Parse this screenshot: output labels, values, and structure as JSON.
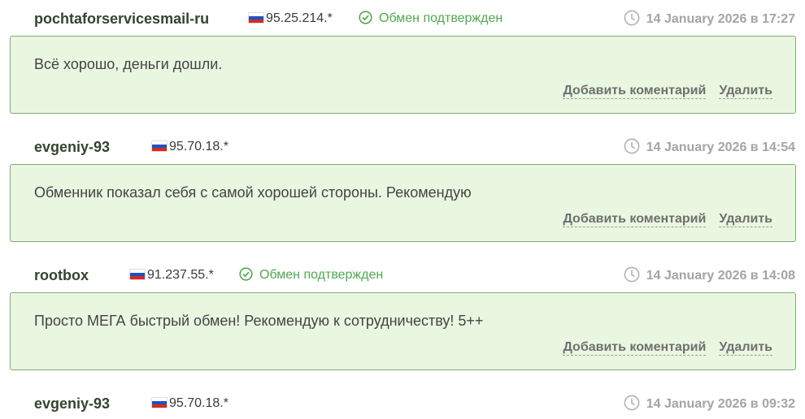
{
  "reviews": [
    {
      "username": "pochtaforservicesmail-ru",
      "ip": "95.25.214.*",
      "confirmed_text": "Обмен подтвержден",
      "date": "14 January 2026 в 17:27",
      "message": "Всё хорошо, деньги дошли.",
      "add_comment": "Добавить коментарий",
      "delete": "Удалить"
    },
    {
      "username": "evgeniy-93",
      "ip": "95.70.18.*",
      "date": "14 January 2026 в 14:54",
      "message": "Обменник показал себя с самой хорошей стороны. Рекомендую",
      "add_comment": "Добавить коментарий",
      "delete": "Удалить"
    },
    {
      "username": "rootbox",
      "ip": "91.237.55.*",
      "confirmed_text": "Обмен подтвержден",
      "date": "14 January 2026 в 14:08",
      "message": "Просто МЕГА быстрый обмен! Рекомендую к сотрудничеству! 5++",
      "add_comment": "Добавить коментарий",
      "delete": "Удалить"
    },
    {
      "username": "evgeniy-93",
      "ip": "95.70.18.*",
      "date": "14 January 2026 в 09:32"
    }
  ],
  "colors": {
    "card_bg": "#e9f7e1",
    "card_border": "#7cad6f",
    "confirmed": "#4fa84f",
    "username": "#33442f",
    "date": "#a4a4a4"
  },
  "icons": {
    "flag": "russia-flag-icon",
    "confirmed": "check-circle-icon",
    "date": "clock-icon"
  }
}
